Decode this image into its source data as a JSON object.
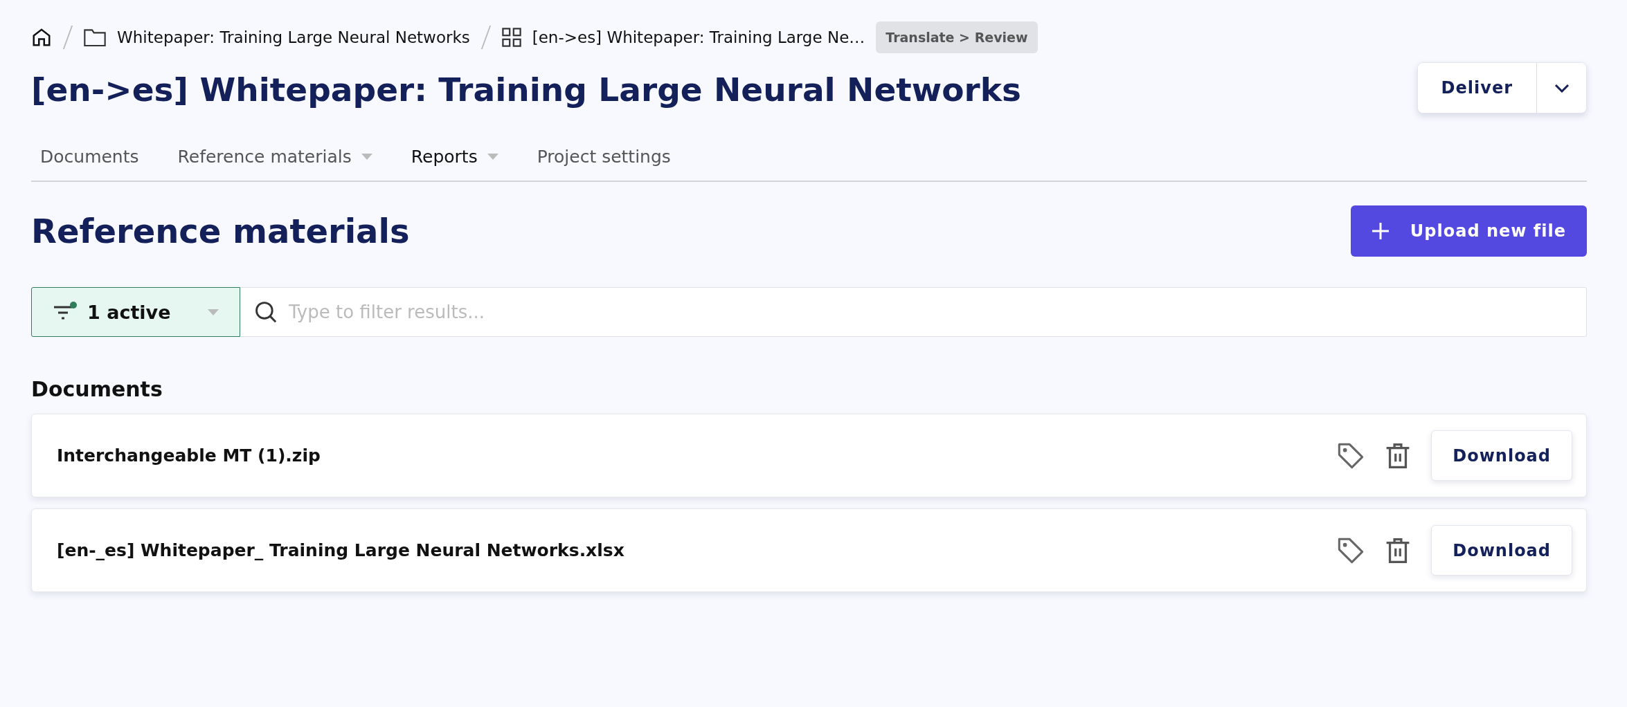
{
  "breadcrumb": [
    {
      "kind": "home"
    },
    {
      "kind": "folder",
      "label": "Whitepaper: Training Large Neural Networks"
    },
    {
      "kind": "project",
      "label": "[en->es] Whitepaper: Training Large Ne…"
    }
  ],
  "status_badge": "Translate > Review",
  "title": "[en->es] Whitepaper: Training Large Neural Networks",
  "deliver_button": "Deliver",
  "tabs": [
    {
      "label": "Documents",
      "selected": false,
      "has_menu": false
    },
    {
      "label": "Reference materials",
      "selected": false,
      "has_menu": true
    },
    {
      "label": "Reports",
      "selected": true,
      "has_menu": true
    },
    {
      "label": "Project settings",
      "selected": false,
      "has_menu": false
    }
  ],
  "section_title": "Reference materials",
  "upload_button": "Upload new file",
  "filter": {
    "label": "1 active",
    "active": true
  },
  "search": {
    "placeholder": "Type to filter results..."
  },
  "group_title": "Documents",
  "files": [
    {
      "name": "Interchangeable MT (1).zip",
      "action": "Download"
    },
    {
      "name": "[en-_es] Whitepaper_ Training Large Neural Networks.xlsx",
      "action": "Download"
    }
  ]
}
